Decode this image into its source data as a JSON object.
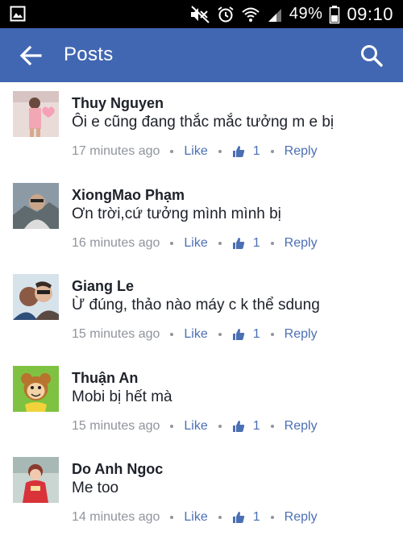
{
  "status_bar": {
    "battery": "49%",
    "time": "09:10"
  },
  "app_bar": {
    "title": "Posts",
    "back_icon": "arrow-left-icon",
    "search_icon": "search-icon"
  },
  "colors": {
    "app_bar": "#4267b2",
    "link": "#4b6fb3",
    "meta": "#90949c",
    "text": "#1d2129"
  },
  "comments": [
    {
      "name": "Thuy Nguyen",
      "text": "Ôi e cũng đang thắc mắc tưởng m e bị",
      "time": "17 minutes ago",
      "like_label": "Like",
      "like_count": "1",
      "reply_label": "Reply"
    },
    {
      "name": "XiongMao Phạm",
      "text": "Ơn trời,cứ tưởng mình mình bị",
      "time": "16 minutes ago",
      "like_label": "Like",
      "like_count": "1",
      "reply_label": "Reply"
    },
    {
      "name": "Giang Le",
      "text": "Ừ đúng, thảo nào máy c k thể sdung",
      "time": "15 minutes ago",
      "like_label": "Like",
      "like_count": "1",
      "reply_label": "Reply"
    },
    {
      "name": "Thuận An",
      "text": "Mobi bị hết mà",
      "time": "15 minutes ago",
      "like_label": "Like",
      "like_count": "1",
      "reply_label": "Reply"
    },
    {
      "name": "Do Anh Ngoc",
      "text": "Me too",
      "time": "14 minutes ago",
      "like_label": "Like",
      "like_count": "1",
      "reply_label": "Reply"
    }
  ]
}
